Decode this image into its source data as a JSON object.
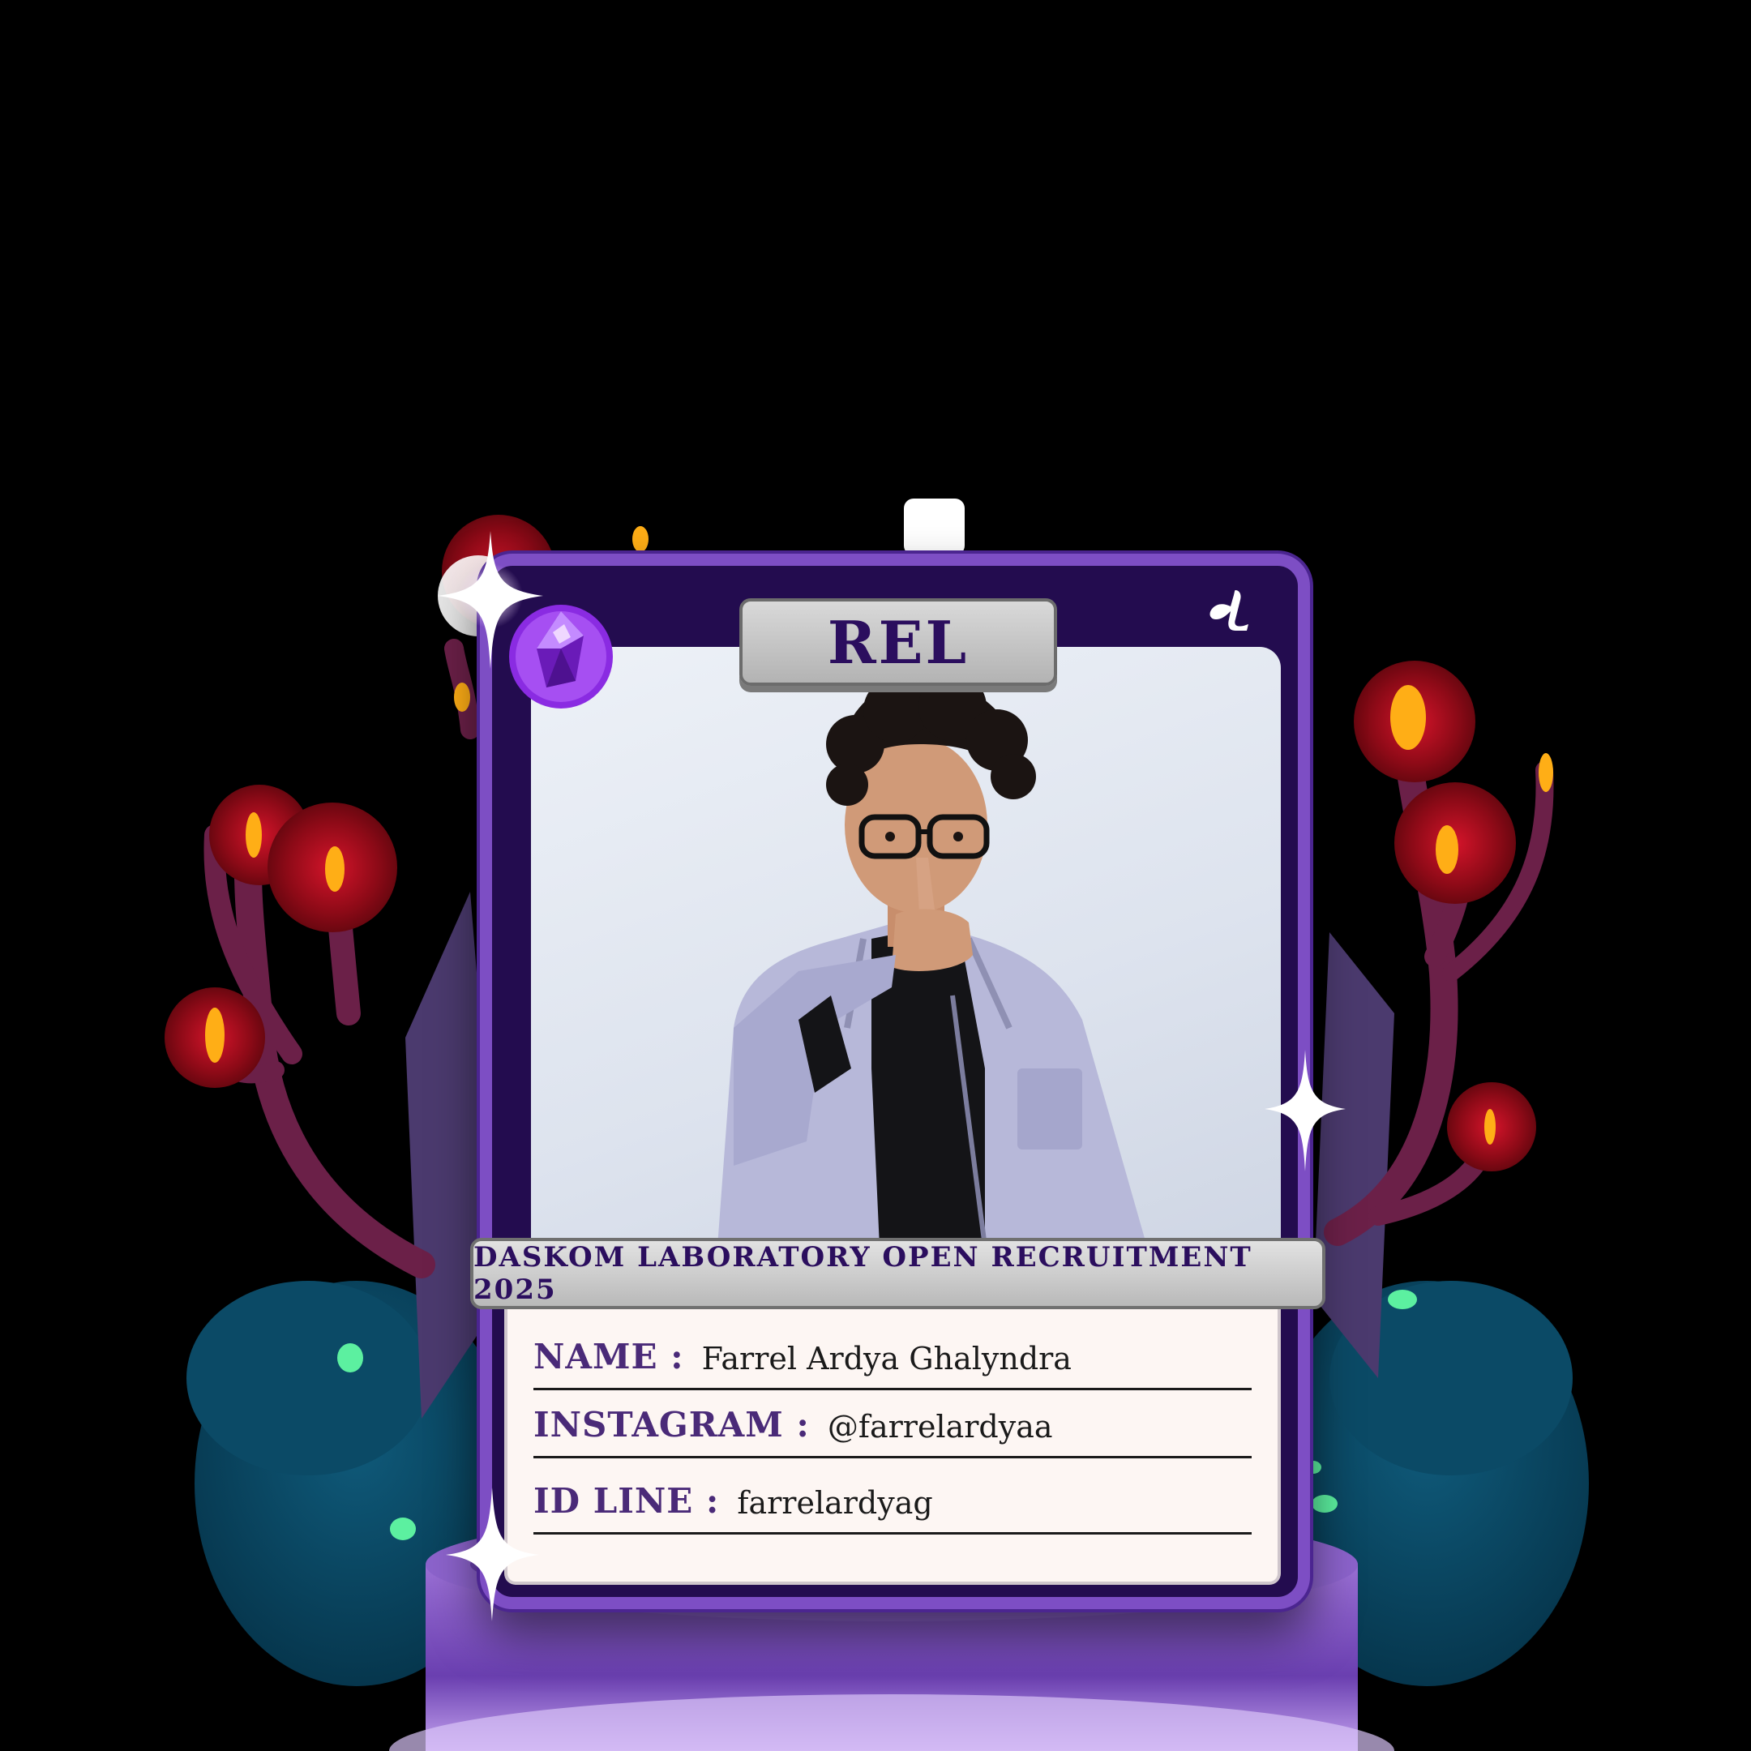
{
  "card": {
    "title": "REL",
    "banner_text": "DASKOM LABORATORY OPEN RECRUITMENT 2025",
    "logo_icon": "daskom-logo-icon",
    "gem_icon": "purple-crystal-gem-icon"
  },
  "profile": {
    "name_label": "NAME :",
    "name_value": "Farrel Ardya Ghalyndra",
    "instagram_label": "INSTAGRAM :",
    "instagram_value": "@farrelardyaa",
    "line_label": "ID LINE :",
    "line_value": "farrelardyag"
  },
  "colors": {
    "card_frame": "#7d4ec4",
    "card_inner": "#230c4f",
    "title_text": "#2b0e5e",
    "label_text": "#4a2a78",
    "info_background": "#fdf6f3",
    "tree_red": "#8d0a17",
    "tree_flame": "#ffae16",
    "bush_teal": "#0b4a66",
    "pedestal_purple": "#7a4fb8",
    "sparkle_glow": "#f3d9ff"
  }
}
